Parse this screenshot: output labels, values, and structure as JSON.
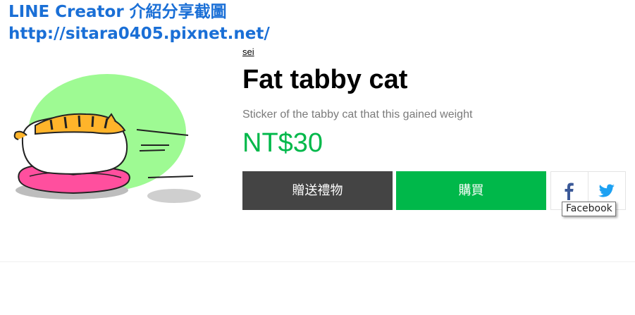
{
  "watermark": {
    "line1": "LINE Creator 介紹分享截圖",
    "line2": "http://sitara0405.pixnet.net/"
  },
  "product": {
    "author": "sei",
    "title": "Fat tabby cat",
    "description": "Sticker of the tabby cat that this gained weight",
    "price": "NT$30"
  },
  "actions": {
    "gift_label": "贈送禮物",
    "buy_label": "購買"
  },
  "share": {
    "facebook_icon": "facebook-icon",
    "twitter_icon": "twitter-icon",
    "tooltip": "Facebook"
  },
  "colors": {
    "watermark": "#1a6fd6",
    "price": "#00b84a",
    "gift_button": "#444444",
    "buy_button": "#00b84a",
    "facebook": "#3b5998",
    "twitter": "#1da1f2"
  }
}
